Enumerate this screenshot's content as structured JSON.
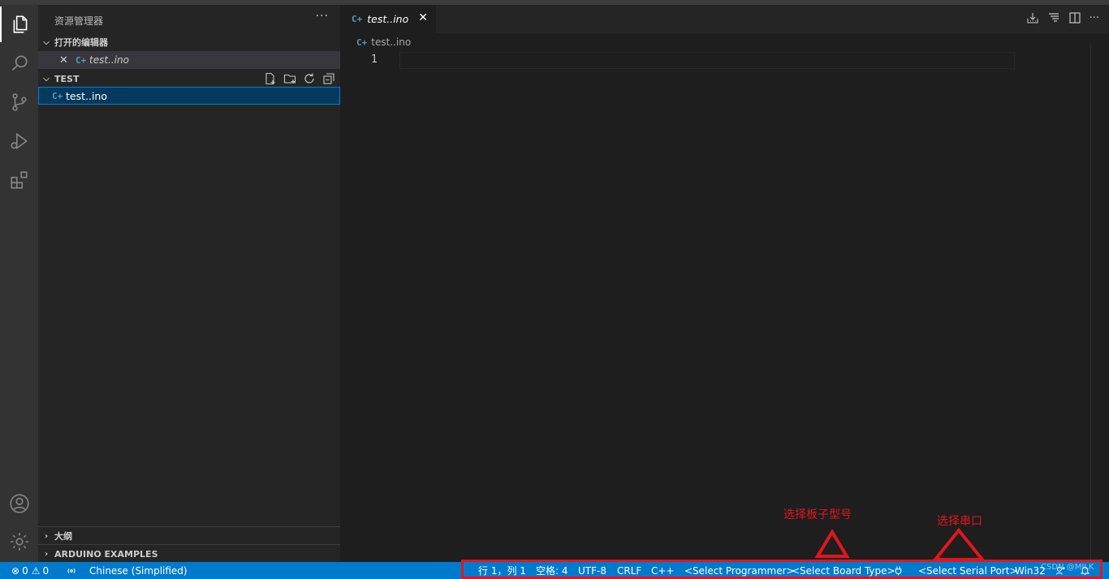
{
  "sidebar": {
    "title": "资源管理器",
    "more_label": "···",
    "open_editors": {
      "heading": "打开的编辑器",
      "items": [
        {
          "icon_text": "C+",
          "name": "test..ino"
        }
      ]
    },
    "workspace": {
      "heading": "TEST",
      "files": [
        {
          "icon_text": "C+",
          "name": "test..ino"
        }
      ]
    },
    "outline_heading": "大纲",
    "arduino_heading": "ARDUINO EXAMPLES"
  },
  "editor": {
    "tab": {
      "icon_text": "C+",
      "name": "test..ino",
      "close": "✕"
    },
    "breadcrumb": {
      "icon_text": "C+",
      "name": "test..ino"
    },
    "line_numbers": [
      "1"
    ],
    "more_label": "···"
  },
  "statusbar": {
    "errors": "0",
    "warnings": "0",
    "language_pack": "Chinese (Simplified)",
    "cursor": "行 1，列 1",
    "indent": "空格: 4",
    "encoding": "UTF-8",
    "eol": "CRLF",
    "language": "C++",
    "programmer": "<Select Programmer>",
    "board": "<Select Board Type>",
    "serial_port": "<Select Serial Port>",
    "platform": "Win32"
  },
  "annotations": {
    "board_label": "选择板子型号",
    "port_label": "选择串口",
    "color": "#e0161e"
  },
  "watermark": "CSDN @MILK",
  "colors": {
    "statusbar": "#007acc",
    "selection": "#04395e",
    "file_icon": "#519aba"
  }
}
